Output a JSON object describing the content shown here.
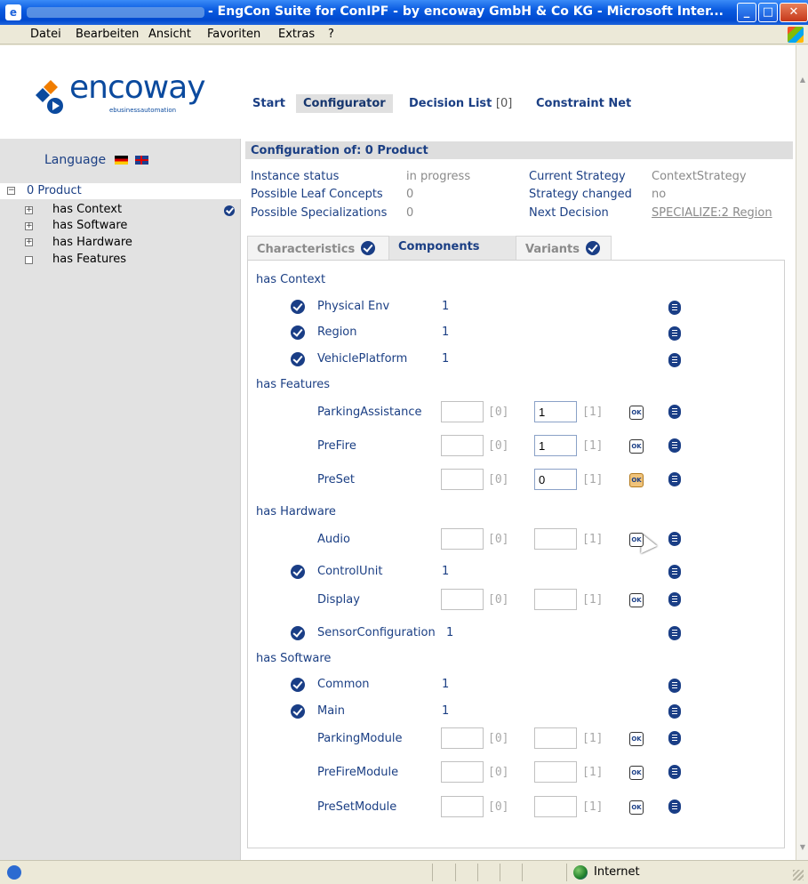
{
  "window": {
    "title": "- EngCon Suite for ConIPF - by encoway GmbH & Co KG - Microsoft Inter...",
    "buttons": {
      "minimize": "_",
      "maximize": "□",
      "close": "✕"
    }
  },
  "menu": [
    "Datei",
    "Bearbeiten",
    "Ansicht",
    "Favoriten",
    "Extras",
    "?"
  ],
  "logo": {
    "brand": "encoway",
    "tagline": "ebusinessautomation"
  },
  "language": {
    "label": "Language"
  },
  "tree": {
    "root": "0 Product",
    "items": [
      {
        "label": "has Context",
        "toggle": "+",
        "checked": true
      },
      {
        "label": "has Software",
        "toggle": "+",
        "checked": false
      },
      {
        "label": "has Hardware",
        "toggle": "+",
        "checked": false
      },
      {
        "label": "has Features",
        "toggle": "",
        "checked": false
      }
    ]
  },
  "topnav": [
    {
      "label": "Start",
      "count": ""
    },
    {
      "label": "Configurator",
      "count": ""
    },
    {
      "label": "Decision List",
      "count": "[0]"
    },
    {
      "label": "Constraint Net",
      "count": ""
    }
  ],
  "config": {
    "heading": "Configuration of: 0 Product",
    "left": [
      {
        "label": "Instance status",
        "value": "in progress"
      },
      {
        "label": "Possible Leaf Concepts",
        "value": "0"
      },
      {
        "label": "Possible Specializations",
        "value": "0"
      }
    ],
    "right": [
      {
        "label": "Current Strategy",
        "value": "ContextStrategy"
      },
      {
        "label": "Strategy changed",
        "value": "no"
      },
      {
        "label": "Next Decision",
        "value": "SPECIALIZE:2 Region"
      }
    ]
  },
  "tabs": [
    "Characteristics",
    "Components",
    "Variants"
  ],
  "components": {
    "ok_label": "OK",
    "groups": [
      {
        "name": "has Context",
        "rows": [
          {
            "label": "Physical Env",
            "value": "1"
          },
          {
            "label": "Region",
            "value": "1"
          },
          {
            "label": "VehiclePlatform",
            "value": "1"
          }
        ]
      },
      {
        "name": "has Features",
        "rows": [
          {
            "label": "ParkingAssistance",
            "min": "",
            "min_bracket": "[0]",
            "max": "1",
            "max_bracket": "[1]"
          },
          {
            "label": "PreFire",
            "min": "",
            "min_bracket": "[0]",
            "max": "1",
            "max_bracket": "[1]"
          },
          {
            "label": "PreSet",
            "min": "",
            "min_bracket": "[0]",
            "max": "0",
            "max_bracket": "[1]"
          }
        ]
      },
      {
        "name": "has Hardware",
        "rows": [
          {
            "label": "Audio",
            "min": "",
            "min_bracket": "[0]",
            "max": "",
            "max_bracket": "[1]"
          },
          {
            "label": "ControlUnit",
            "value": "1"
          },
          {
            "label": "Display",
            "min": "",
            "min_bracket": "[0]",
            "max": "",
            "max_bracket": "[1]"
          },
          {
            "label": "SensorConfiguration",
            "value": "1"
          }
        ]
      },
      {
        "name": "has Software",
        "rows": [
          {
            "label": "Common",
            "value": "1"
          },
          {
            "label": "Main",
            "value": "1"
          },
          {
            "label": "ParkingModule",
            "min": "",
            "min_bracket": "[0]",
            "max": "",
            "max_bracket": "[1]"
          },
          {
            "label": "PreFireModule",
            "min": "",
            "min_bracket": "[0]",
            "max": "",
            "max_bracket": "[1]"
          },
          {
            "label": "PreSetModule",
            "min": "",
            "min_bracket": "[0]",
            "max": "",
            "max_bracket": "[1]"
          }
        ]
      }
    ]
  },
  "status": {
    "zone": "Internet"
  },
  "colors": {
    "accent": "#1b3f84",
    "titlebar": "#0a5be0",
    "muted": "#8a8a8a"
  }
}
